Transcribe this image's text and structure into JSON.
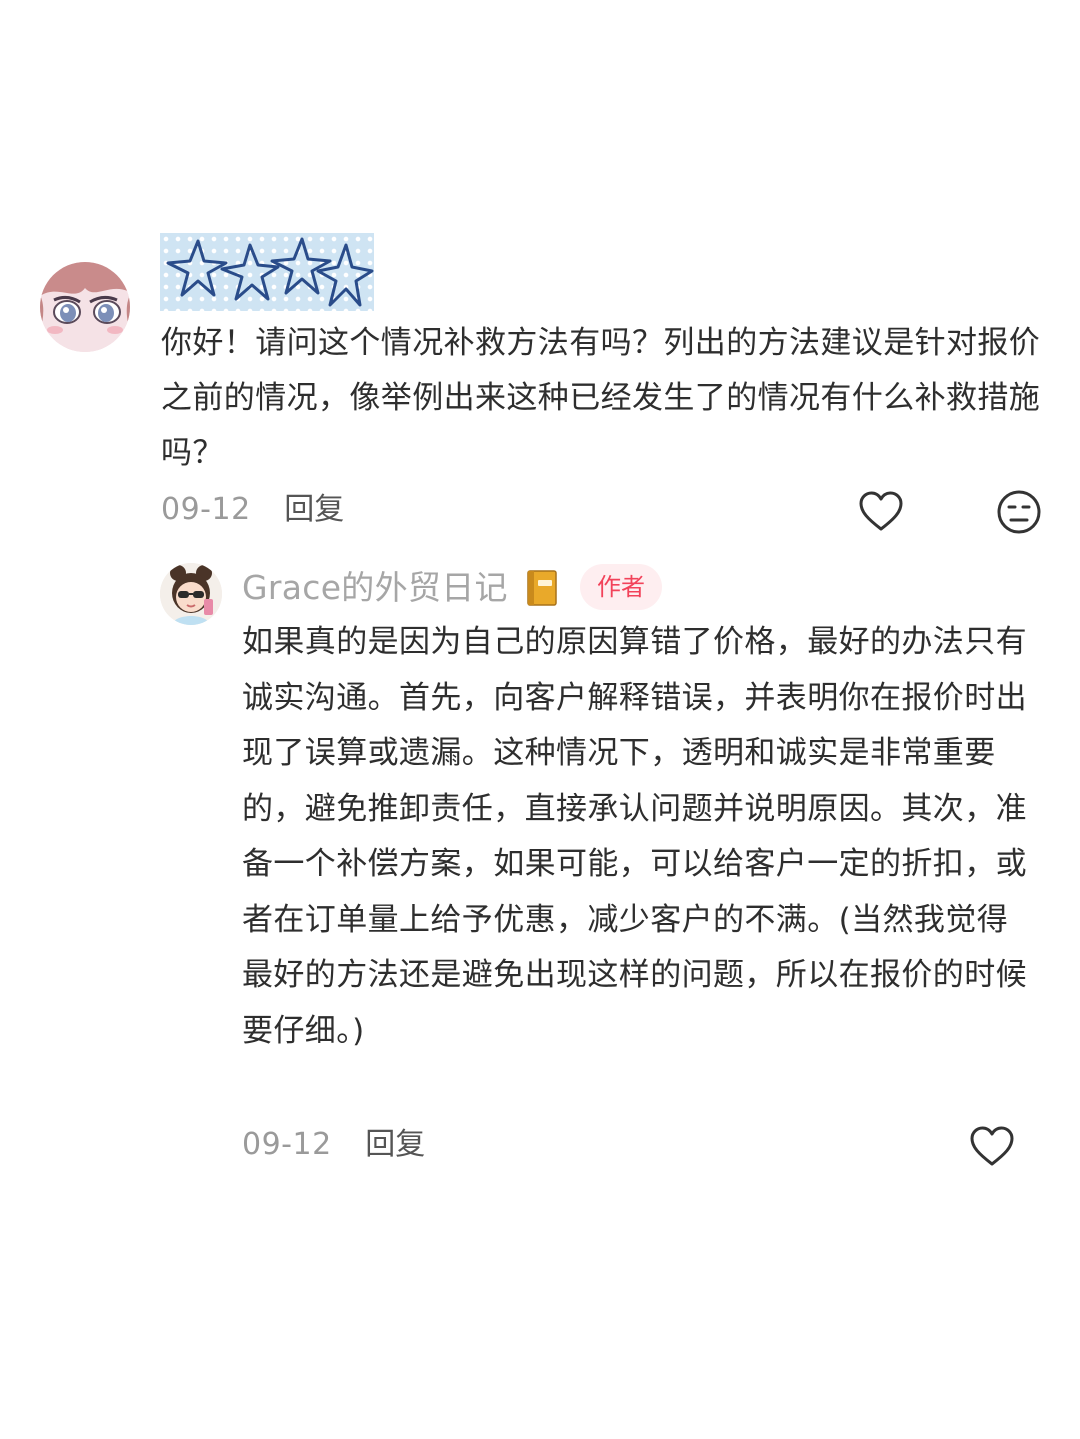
{
  "comment": {
    "text": "你好！请问这个情况补救方法有吗？列出的方法建议是针对报价之前的情况，像举例出来这种已经发生了的情况有什么补救措施吗？",
    "date": "09-12",
    "reply_label": "回复",
    "avatar_icon": "anime-girl-avatar",
    "username_icon": "sticker-stars-username"
  },
  "reply": {
    "author": "Grace的外贸日记",
    "author_emoji_icon": "notebook-icon",
    "badge": "作者",
    "text": "如果真的是因为自己的原因算错了价格，最好的办法只有诚实沟通。首先，向客户解释错误，并表明你在报价时出现了误算或遗漏。这种情况下，透明和诚实是非常重要的，避免推卸责任，直接承认问题并说明原因。其次，准备一个补偿方案，如果可能，可以给客户一定的折扣，或者在订单量上给予优惠，减少客户的不满。(当然我觉得最好的方法还是避免出现这样的问题，所以在报价的时候要仔细。)",
    "date": "09-12",
    "reply_label": "回复"
  },
  "colors": {
    "badge_text": "#f2435a",
    "badge_bg": "#feeef0",
    "muted": "#9a9a9a",
    "icon_stroke": "#333333"
  }
}
